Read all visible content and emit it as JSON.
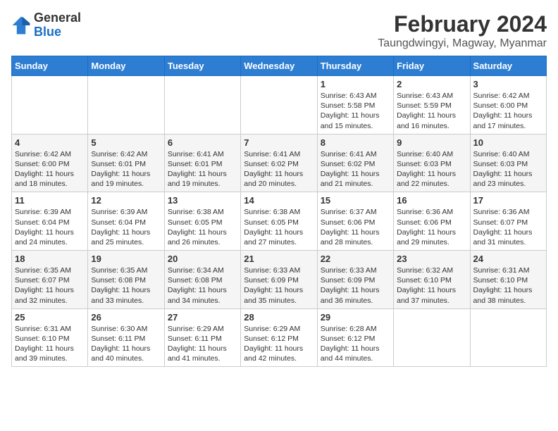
{
  "logo": {
    "general": "General",
    "blue": "Blue"
  },
  "header": {
    "month": "February 2024",
    "location": "Taungdwingyi, Magway, Myanmar"
  },
  "weekdays": [
    "Sunday",
    "Monday",
    "Tuesday",
    "Wednesday",
    "Thursday",
    "Friday",
    "Saturday"
  ],
  "weeks": [
    [
      {
        "day": "",
        "info": ""
      },
      {
        "day": "",
        "info": ""
      },
      {
        "day": "",
        "info": ""
      },
      {
        "day": "",
        "info": ""
      },
      {
        "day": "1",
        "info": "Sunrise: 6:43 AM\nSunset: 5:58 PM\nDaylight: 11 hours and 15 minutes."
      },
      {
        "day": "2",
        "info": "Sunrise: 6:43 AM\nSunset: 5:59 PM\nDaylight: 11 hours and 16 minutes."
      },
      {
        "day": "3",
        "info": "Sunrise: 6:42 AM\nSunset: 6:00 PM\nDaylight: 11 hours and 17 minutes."
      }
    ],
    [
      {
        "day": "4",
        "info": "Sunrise: 6:42 AM\nSunset: 6:00 PM\nDaylight: 11 hours and 18 minutes."
      },
      {
        "day": "5",
        "info": "Sunrise: 6:42 AM\nSunset: 6:01 PM\nDaylight: 11 hours and 19 minutes."
      },
      {
        "day": "6",
        "info": "Sunrise: 6:41 AM\nSunset: 6:01 PM\nDaylight: 11 hours and 19 minutes."
      },
      {
        "day": "7",
        "info": "Sunrise: 6:41 AM\nSunset: 6:02 PM\nDaylight: 11 hours and 20 minutes."
      },
      {
        "day": "8",
        "info": "Sunrise: 6:41 AM\nSunset: 6:02 PM\nDaylight: 11 hours and 21 minutes."
      },
      {
        "day": "9",
        "info": "Sunrise: 6:40 AM\nSunset: 6:03 PM\nDaylight: 11 hours and 22 minutes."
      },
      {
        "day": "10",
        "info": "Sunrise: 6:40 AM\nSunset: 6:03 PM\nDaylight: 11 hours and 23 minutes."
      }
    ],
    [
      {
        "day": "11",
        "info": "Sunrise: 6:39 AM\nSunset: 6:04 PM\nDaylight: 11 hours and 24 minutes."
      },
      {
        "day": "12",
        "info": "Sunrise: 6:39 AM\nSunset: 6:04 PM\nDaylight: 11 hours and 25 minutes."
      },
      {
        "day": "13",
        "info": "Sunrise: 6:38 AM\nSunset: 6:05 PM\nDaylight: 11 hours and 26 minutes."
      },
      {
        "day": "14",
        "info": "Sunrise: 6:38 AM\nSunset: 6:05 PM\nDaylight: 11 hours and 27 minutes."
      },
      {
        "day": "15",
        "info": "Sunrise: 6:37 AM\nSunset: 6:06 PM\nDaylight: 11 hours and 28 minutes."
      },
      {
        "day": "16",
        "info": "Sunrise: 6:36 AM\nSunset: 6:06 PM\nDaylight: 11 hours and 29 minutes."
      },
      {
        "day": "17",
        "info": "Sunrise: 6:36 AM\nSunset: 6:07 PM\nDaylight: 11 hours and 31 minutes."
      }
    ],
    [
      {
        "day": "18",
        "info": "Sunrise: 6:35 AM\nSunset: 6:07 PM\nDaylight: 11 hours and 32 minutes."
      },
      {
        "day": "19",
        "info": "Sunrise: 6:35 AM\nSunset: 6:08 PM\nDaylight: 11 hours and 33 minutes."
      },
      {
        "day": "20",
        "info": "Sunrise: 6:34 AM\nSunset: 6:08 PM\nDaylight: 11 hours and 34 minutes."
      },
      {
        "day": "21",
        "info": "Sunrise: 6:33 AM\nSunset: 6:09 PM\nDaylight: 11 hours and 35 minutes."
      },
      {
        "day": "22",
        "info": "Sunrise: 6:33 AM\nSunset: 6:09 PM\nDaylight: 11 hours and 36 minutes."
      },
      {
        "day": "23",
        "info": "Sunrise: 6:32 AM\nSunset: 6:10 PM\nDaylight: 11 hours and 37 minutes."
      },
      {
        "day": "24",
        "info": "Sunrise: 6:31 AM\nSunset: 6:10 PM\nDaylight: 11 hours and 38 minutes."
      }
    ],
    [
      {
        "day": "25",
        "info": "Sunrise: 6:31 AM\nSunset: 6:10 PM\nDaylight: 11 hours and 39 minutes."
      },
      {
        "day": "26",
        "info": "Sunrise: 6:30 AM\nSunset: 6:11 PM\nDaylight: 11 hours and 40 minutes."
      },
      {
        "day": "27",
        "info": "Sunrise: 6:29 AM\nSunset: 6:11 PM\nDaylight: 11 hours and 41 minutes."
      },
      {
        "day": "28",
        "info": "Sunrise: 6:29 AM\nSunset: 6:12 PM\nDaylight: 11 hours and 42 minutes."
      },
      {
        "day": "29",
        "info": "Sunrise: 6:28 AM\nSunset: 6:12 PM\nDaylight: 11 hours and 44 minutes."
      },
      {
        "day": "",
        "info": ""
      },
      {
        "day": "",
        "info": ""
      }
    ]
  ]
}
